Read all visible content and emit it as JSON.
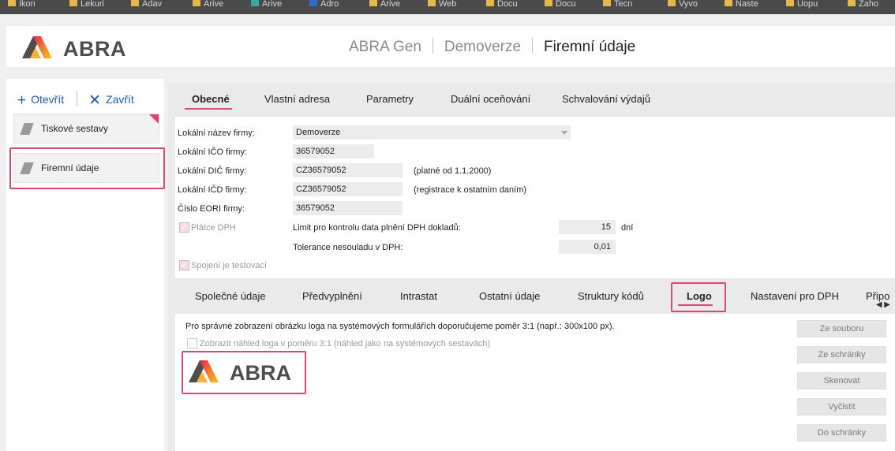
{
  "browser_tabs": [
    "Ikon",
    "Lekuri",
    "Adav",
    "Arive",
    "Arive",
    "Adro",
    "Arive",
    "Web",
    "Docu",
    "Docu",
    "Tecn",
    "Vyvo",
    "Naste",
    "Uopu",
    "Zaho"
  ],
  "header": {
    "logo_text": "ABRA",
    "breadcrumb": [
      "ABRA Gen",
      "Demoverze",
      "Firemní údaje"
    ]
  },
  "sidebar": {
    "open_label": "Otevřít",
    "close_label": "Zavřít",
    "items": [
      {
        "label": "Tiskové sestavy"
      },
      {
        "label": "Firemní údaje"
      }
    ]
  },
  "top_tabs": [
    {
      "label": "Obecné",
      "active": true
    },
    {
      "label": "Vlastní adresa"
    },
    {
      "label": "Parametry"
    },
    {
      "label": "Duální oceňování"
    },
    {
      "label": "Schvalování výdajů"
    }
  ],
  "form": {
    "local_name_label": "Lokální název firmy:",
    "local_name_value": "Demoverze",
    "ico_label": "Lokální IČO firmy:",
    "ico_value": "36579052",
    "dic_label": "Lokální DIČ firmy:",
    "dic_value": "CZ36579052",
    "dic_note": "(platné od 1.1.2000)",
    "icd_label": "Lokální IČD firmy:",
    "icd_value": "CZ36579052",
    "icd_note": "(registrace k ostatním daním)",
    "eori_label": "Číslo EORI firmy:",
    "eori_value": "36579052",
    "vat_payer_label": "Plátce DPH",
    "vat_limit_label": "Limit pro kontrolu data plnění DPH dokladů:",
    "vat_limit_value": "15",
    "vat_limit_unit": "dní",
    "vat_tolerance_label": "Tolerance nesouladu v DPH:",
    "vat_tolerance_value": "0,01",
    "test_conn_label": "Spojení je testovací"
  },
  "bottom_tabs": [
    {
      "label": "Společné údaje"
    },
    {
      "label": "Předvyplnění"
    },
    {
      "label": "Intrastat"
    },
    {
      "label": "Ostatní údaje"
    },
    {
      "label": "Struktury kódů"
    },
    {
      "label": "Logo",
      "active": true
    },
    {
      "label": "Nastavení pro DPH"
    },
    {
      "label": "Připo"
    }
  ],
  "logo_section": {
    "hint": "Pro správné zobrazení obrázku loga na systémových formulářích doporučujeme poměr 3:1 (např.: 300x100 px).",
    "preview_checkbox_label": "Zobrazit náhled loga v poměru 3:1 (náhled jako na systémových sestavách)",
    "logo_text": "ABRA",
    "buttons": [
      "Ze souboru",
      "Ze schránky",
      "Skenovat",
      "Vyčistit",
      "Do schránky"
    ]
  },
  "colors": {
    "accent": "#d9467a",
    "link": "#1f5aa6"
  }
}
